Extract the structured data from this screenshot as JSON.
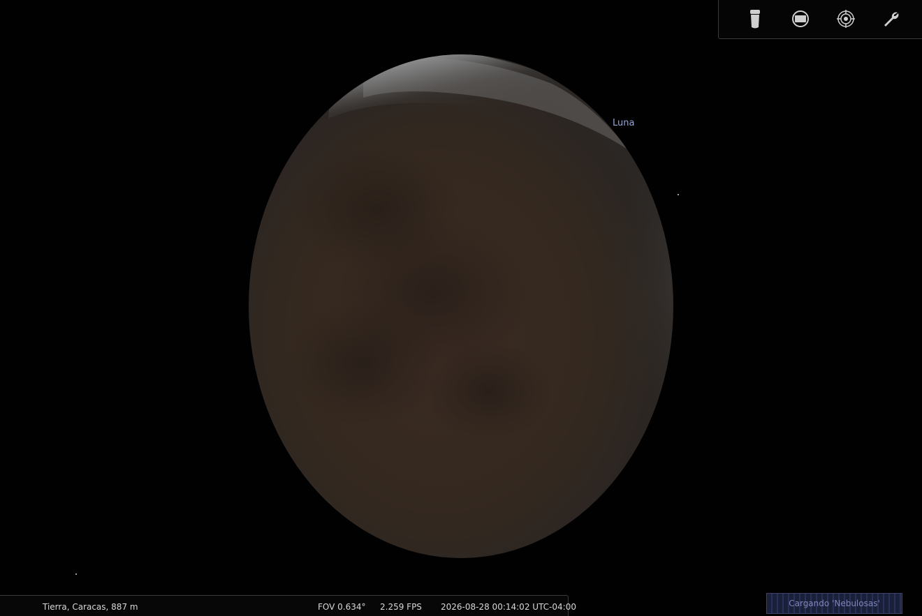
{
  "sky": {
    "object_label": "Luna"
  },
  "toolbar": {
    "items": [
      {
        "icon": "flashlight-icon",
        "label": ""
      },
      {
        "icon": "fullscreen-icon",
        "label": ""
      },
      {
        "icon": "target-icon",
        "label": ""
      },
      {
        "icon": "wrench-icon",
        "label": ""
      }
    ]
  },
  "status_bar": {
    "location": "Tierra, Caracas, 887 m",
    "fov": "FOV 0.634°",
    "fps": "2.259 FPS",
    "datetime": "2026-08-28 00:14:02 UTC-04:00"
  },
  "loading": {
    "text": "Cargando 'Nebulosas'"
  },
  "colors": {
    "label_color": "#9aa7d4",
    "moon_dark": "#2e2622",
    "moon_lit": "#8e8e8e"
  }
}
